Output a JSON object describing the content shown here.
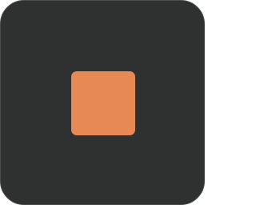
{
  "app_icon": {
    "name": "stop-icon",
    "background_color": "#2f3130",
    "symbol_color": "#e68954"
  }
}
